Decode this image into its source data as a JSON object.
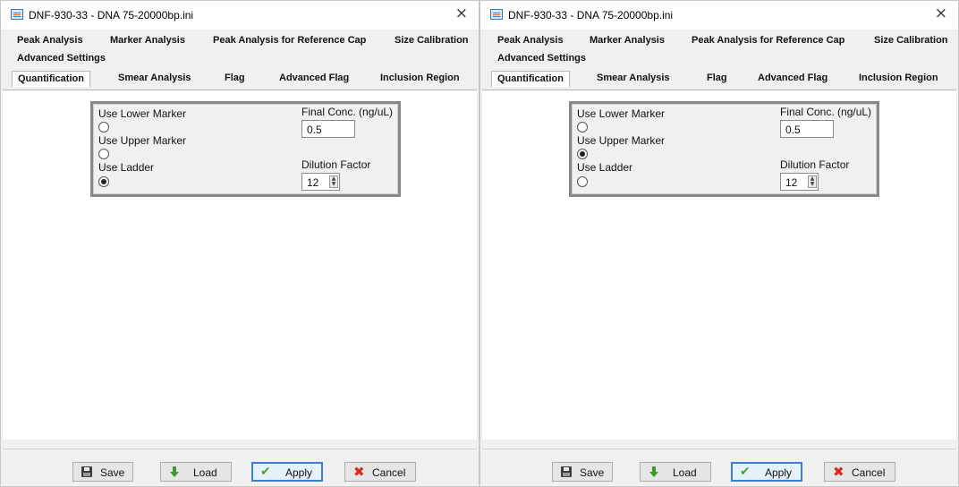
{
  "windows": [
    {
      "title": "DNF-930-33 - DNA 75-20000bp.ini",
      "close_glyph": "×",
      "tabs_row1": [
        "Peak Analysis",
        "Marker Analysis",
        "Peak Analysis for Reference Cap",
        "Size Calibration"
      ],
      "tabs_row2": [
        "Advanced Settings"
      ],
      "tabs_row3": [
        "Quantification",
        "Smear Analysis",
        "Flag",
        "Advanced Flag",
        "Inclusion Region"
      ],
      "active_tab": "Quantification",
      "options": [
        {
          "label": "Use Lower Marker",
          "selected": false
        },
        {
          "label": "Use Upper Marker",
          "selected": false
        },
        {
          "label": "Use Ladder",
          "selected": true
        }
      ],
      "final_conc_label": "Final Conc. (ng/uL)",
      "final_conc_value": "0.5",
      "dilution_label": "Dilution Factor",
      "dilution_value": "12",
      "buttons": {
        "save": "Save",
        "load": "Load",
        "apply": "Apply",
        "cancel": "Cancel"
      }
    },
    {
      "title": "DNF-930-33 - DNA 75-20000bp.ini",
      "close_glyph": "×",
      "tabs_row1": [
        "Peak Analysis",
        "Marker Analysis",
        "Peak Analysis for Reference Cap",
        "Size Calibration"
      ],
      "tabs_row2": [
        "Advanced Settings"
      ],
      "tabs_row3": [
        "Quantification",
        "Smear Analysis",
        "Flag",
        "Advanced Flag",
        "Inclusion Region"
      ],
      "active_tab": "Quantification",
      "options": [
        {
          "label": "Use Lower Marker",
          "selected": false
        },
        {
          "label": "Use Upper Marker",
          "selected": true
        },
        {
          "label": "Use Ladder",
          "selected": false
        }
      ],
      "final_conc_label": "Final Conc. (ng/uL)",
      "final_conc_value": "0.5",
      "dilution_label": "Dilution Factor",
      "dilution_value": "12",
      "buttons": {
        "save": "Save",
        "load": "Load",
        "apply": "Apply",
        "cancel": "Cancel"
      }
    }
  ],
  "icons": {
    "app": "app-icon",
    "save": "floppy-disk-icon",
    "load": "download-arrow-icon",
    "apply": "checkmark-icon",
    "cancel": "red-x-icon"
  },
  "colors": {
    "apply_border": "#3c7fd0",
    "load_green": "#3f9a2e",
    "cancel_red": "#d42b1e"
  }
}
